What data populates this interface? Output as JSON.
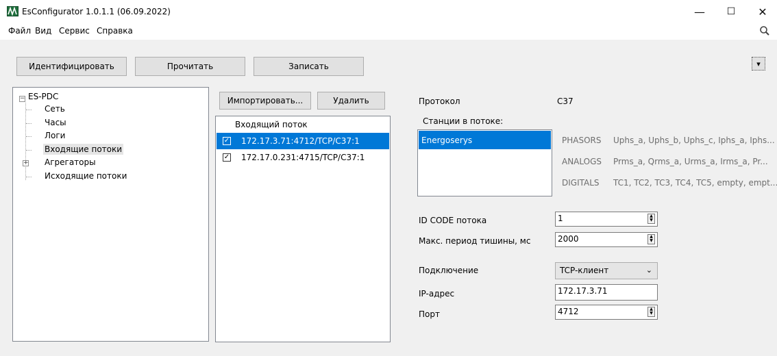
{
  "window": {
    "title": "EsConfigurator 1.0.1.1 (06.09.2022)",
    "minimize": "—",
    "maximize": "☐",
    "close": "✕"
  },
  "menu": [
    "Файл",
    "Вид",
    "Сервис",
    "Справка"
  ],
  "toolbar": {
    "identify": "Идентифицировать",
    "read": "Прочитать",
    "write": "Записать",
    "dropdown_glyph": "▾"
  },
  "tree": {
    "root": "ES-PDC",
    "items": [
      "Сеть",
      "Часы",
      "Логи",
      "Входящие потоки",
      "Агрегаторы",
      "Исходящие потоки"
    ],
    "selected": "Входящие потоки"
  },
  "streams": {
    "import_label": "Импортировать...",
    "delete_label": "Удалить",
    "column_header": "Входящий поток",
    "rows": [
      {
        "label": "172.17.3.71:4712/TCP/C37:1",
        "checked": true,
        "selected": true
      },
      {
        "label": "172.17.0.231:4715/TCP/C37:1",
        "checked": true,
        "selected": false
      }
    ]
  },
  "details": {
    "protocol_label": "Протокол",
    "protocol_value": "C37",
    "stations_label": "Станции в потоке:",
    "station": "Energoserys",
    "phasors_label": "PHASORS",
    "phasors_value": "Uphs_a, Uphs_b, Uphs_c, Iphs_a, Iphs...",
    "analogs_label": "ANALOGS",
    "analogs_value": "Prms_a, Qrms_a, Urms_a, Irms_a, Pr...",
    "digitals_label": "DIGITALS",
    "digitals_value": "TC1, TC2, TC3, TC4, TC5, empty, empt...",
    "idcode_label": "ID CODE потока",
    "idcode_value": "1",
    "silence_label": "Макс. период тишины, мс",
    "silence_value": "2000",
    "connection_label": "Подключение",
    "connection_value": "TCP-клиент",
    "ip_label": "IP-адрес",
    "ip_value": "172.17.3.71",
    "port_label": "Порт",
    "port_value": "4712"
  },
  "colors": {
    "selection": "#0078d7",
    "logo": "#1f6f3d"
  }
}
